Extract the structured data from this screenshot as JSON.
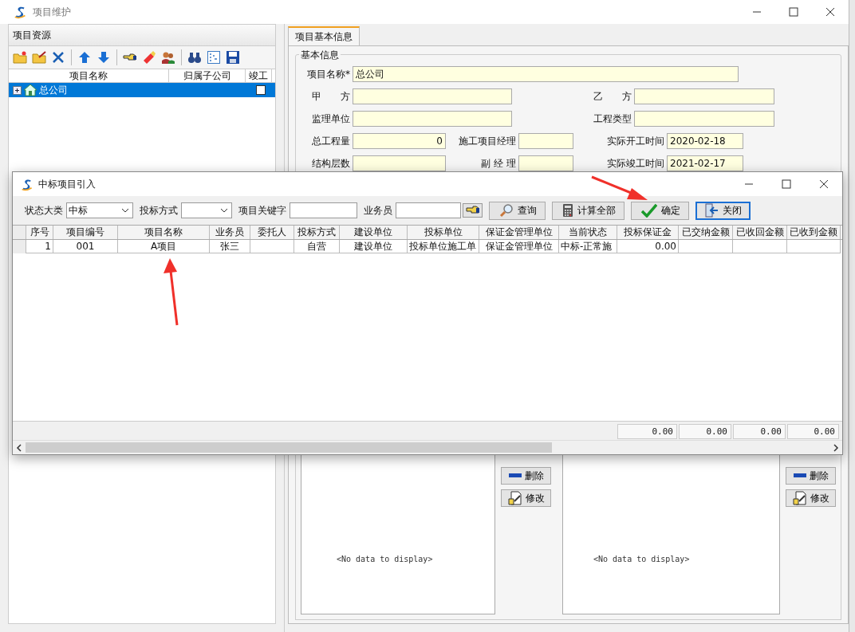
{
  "main_window": {
    "title": "项目维护"
  },
  "resources_panel": {
    "title": "项目资源",
    "tree_columns": [
      "项目名称",
      "归属子公司",
      "竣工"
    ],
    "tree": [
      {
        "name": "总公司",
        "selected": true,
        "completed": false,
        "expanded": false
      }
    ]
  },
  "tabs": [
    {
      "label": "项目基本信息",
      "selected": true
    }
  ],
  "basic_info": {
    "title": "基本信息",
    "rows": [
      [
        {
          "label": "项目名称*",
          "value": "总公司"
        }
      ],
      [
        {
          "label": "甲　　方"
        },
        {
          "label": "乙　　方"
        }
      ],
      [
        {
          "label": "监理单位"
        },
        {
          "label": "工程类型"
        }
      ],
      [
        {
          "label": "总工程量",
          "value": "0"
        },
        {
          "label": "施工项目经理"
        },
        {
          "label": "实际开工时间",
          "value": "2020-02-18"
        }
      ],
      [
        {
          "label": "结构层数"
        },
        {
          "label": "副 经 理"
        },
        {
          "label": "实际竣工时间",
          "value": "2021-02-17"
        }
      ]
    ]
  },
  "list_panels": [
    {
      "empty_text": "<No data to display>",
      "buttons": [
        "删除",
        "修改"
      ]
    },
    {
      "empty_text": "<No data to display>",
      "buttons": [
        "删除",
        "修改"
      ]
    }
  ],
  "dialog": {
    "title": "中标项目引入",
    "filters": [
      {
        "label": "状态大类",
        "kind": "select",
        "value": "中标"
      },
      {
        "label": "投标方式",
        "kind": "select"
      },
      {
        "label": "项目关键字",
        "kind": "text"
      },
      {
        "label": "业务员",
        "kind": "picker"
      }
    ],
    "buttons": [
      {
        "label": "查询",
        "focused": false
      },
      {
        "label": "计算全部",
        "focused": false
      },
      {
        "label": "确定",
        "focused": false
      },
      {
        "label": "关闭",
        "focused": true
      }
    ],
    "columns": [
      "序号",
      "项目编号",
      "项目名称",
      "业务员",
      "委托人",
      "投标方式",
      "建设单位",
      "投标单位",
      "保证金管理单位",
      "当前状态",
      "投标保证金",
      "已交纳金额",
      "已收回金额",
      "已收到金额"
    ],
    "rows": [
      [
        "1",
        "001",
        "A项目",
        "张三",
        null,
        "自营",
        "建设单位",
        "投标单位施工单",
        "保证金管理单位",
        "中标-正常施",
        "0.00",
        null,
        null,
        null
      ]
    ],
    "totals": [
      "0.00",
      "0.00",
      "0.00",
      "0.00"
    ]
  }
}
